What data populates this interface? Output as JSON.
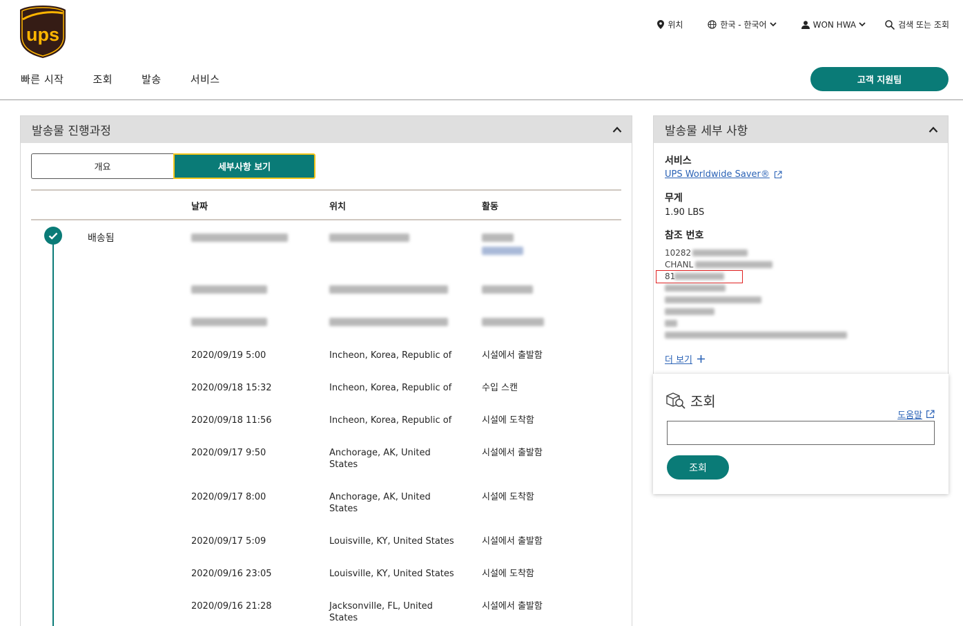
{
  "brand": {
    "logo_text": "ups",
    "accent": "#0a7b77",
    "logo_brown": "#351c15",
    "logo_gold": "#ffb500"
  },
  "utility": {
    "location": "위치",
    "language": "한국 - 한국어",
    "user": "WON HWA",
    "search": "검색 또는 조회"
  },
  "nav": {
    "items": [
      "빠른 시작",
      "조회",
      "발송",
      "서비스"
    ],
    "support_button": "고객 지원팀"
  },
  "progress": {
    "title": "발송물 진행과정",
    "tabs": {
      "overview": "개요",
      "details": "세부사항 보기"
    },
    "columns": {
      "date": "날짜",
      "location": "위치",
      "activity": "활동"
    },
    "status": "배송됨",
    "rows": [
      {
        "date": "2020/09/19  5:00",
        "location": "Incheon, Korea, Republic of",
        "activity": "시설에서 출발함"
      },
      {
        "date": "2020/09/18  15:32",
        "location": "Incheon, Korea, Republic of",
        "activity": "수입 스캔"
      },
      {
        "date": "2020/09/18  11:56",
        "location": "Incheon, Korea, Republic of",
        "activity": "시설에 도착함"
      },
      {
        "date": "2020/09/17  9:50",
        "location": "Anchorage, AK, United States",
        "activity": "시설에서 출발함"
      },
      {
        "date": "2020/09/17  8:00",
        "location": "Anchorage, AK, United States",
        "activity": "시설에 도착함"
      },
      {
        "date": "2020/09/17  5:09",
        "location": "Louisville, KY, United States",
        "activity": "시설에서 출발함"
      },
      {
        "date": "2020/09/16  23:05",
        "location": "Louisville, KY, United States",
        "activity": "시설에 도착함"
      },
      {
        "date": "2020/09/16  21:28",
        "location": "Jacksonville, FL, United States",
        "activity": "시설에서 출발함"
      }
    ]
  },
  "details": {
    "title": "발송물 세부 사항",
    "service_label": "서비스",
    "service_value": "UPS Worldwide Saver®",
    "weight_label": "무게",
    "weight_value": "1.90 LBS",
    "ref_label": "참조 번호",
    "ref_values": [
      "10282",
      "CHANL",
      "81",
      "UX0BYZYZ501",
      "114",
      "UX0BYZYZS",
      "NA",
      "UPS"
    ],
    "more_link": "더 보기"
  },
  "track": {
    "title": "조회",
    "help": "도움말",
    "input_placeholder": "",
    "button": "조회"
  }
}
